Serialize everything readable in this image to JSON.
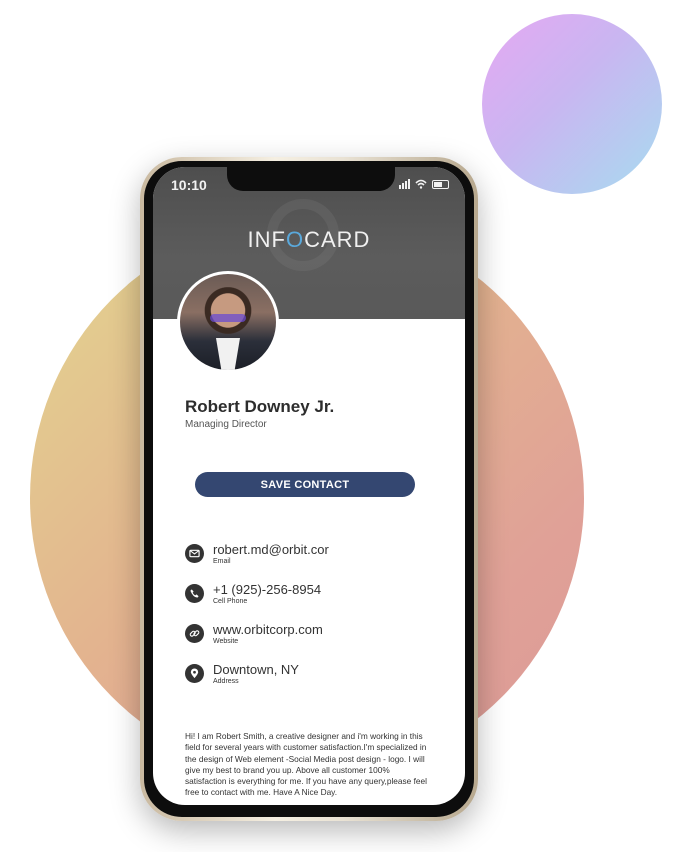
{
  "status_bar": {
    "time": "10:10"
  },
  "brand": {
    "prefix": "INF",
    "accent_letter": "O",
    "suffix": "CARD",
    "accent_color": "#5aa9dc"
  },
  "profile": {
    "name": "Robert Downey Jr.",
    "title": "Managing Director"
  },
  "save_button": {
    "label": "SAVE CONTACT",
    "color": "#344771"
  },
  "contacts": [
    {
      "icon": "email-icon",
      "value": "robert.md@orbit.cor",
      "label": "Email"
    },
    {
      "icon": "phone-icon",
      "value": "+1 (925)-256-8954",
      "label": "Cell Phone"
    },
    {
      "icon": "link-icon",
      "value": "www.orbitcorp.com",
      "label": "Website"
    },
    {
      "icon": "location-pin-icon",
      "value": "Downtown, NY",
      "label": "Address"
    }
  ],
  "bio": "Hi! I am Robert Smith, a creative designer and i'm working in this field for several years with customer satisfaction.I'm specialized in the design of Web element -Social Media post design - logo. I will give my best to brand you up. Above all customer 100% satisfaction is everything for me. If you have any query,please feel free to contact with me. Have A Nice Day."
}
